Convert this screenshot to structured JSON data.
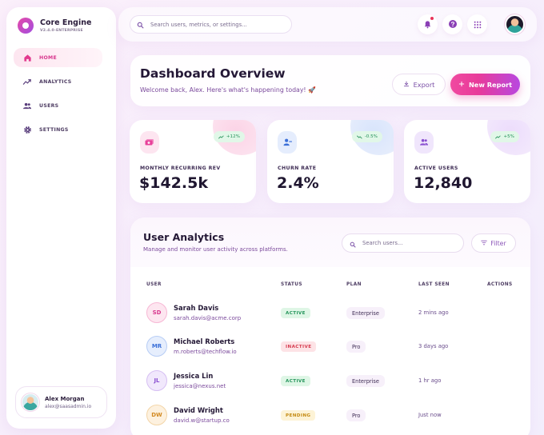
{
  "brand": {
    "name": "Core Engine",
    "version": "V2.4.0-ENTERPRISE"
  },
  "nav": [
    {
      "label": "HOME",
      "icon": "home-icon",
      "active": true
    },
    {
      "label": "ANALYTICS",
      "icon": "analytics-icon",
      "active": false
    },
    {
      "label": "USERS",
      "icon": "users-icon",
      "active": false
    },
    {
      "label": "SETTINGS",
      "icon": "gear-icon",
      "active": false
    }
  ],
  "profile": {
    "name": "Alex Morgan",
    "email": "alex@saasadmin.io"
  },
  "topbar": {
    "search_placeholder": "Search users, metrics, or settings..."
  },
  "hero": {
    "title": "Dashboard Overview",
    "subtitle": "Welcome back, Alex. Here's what's happening today! 🚀",
    "export_label": "Export",
    "new_report_label": "New Report"
  },
  "stats": [
    {
      "label": "MONTHLY RECURRING REV",
      "value": "$142.5k",
      "trend": "+12%",
      "trend_dir": "up",
      "icon": "revenue-icon",
      "accent": "#e8409a"
    },
    {
      "label": "CHURN RATE",
      "value": "2.4%",
      "trend": "-0.5%",
      "trend_dir": "down",
      "icon": "user-minus-icon",
      "accent": "#3a6fd8"
    },
    {
      "label": "ACTIVE USERS",
      "value": "12,840",
      "trend": "+5%",
      "trend_dir": "up",
      "icon": "users-icon",
      "accent": "#8a4fd0"
    }
  ],
  "table": {
    "title": "User Analytics",
    "subtitle": "Manage and monitor user activity across platforms.",
    "search_placeholder": "Search users...",
    "filter_label": "Filter",
    "columns": [
      "USER",
      "STATUS",
      "PLAN",
      "LAST SEEN",
      "ACTIONS"
    ],
    "rows": [
      {
        "initials": "SD",
        "name": "Sarah Davis",
        "email": "sarah.davis@acme.corp",
        "status": "ACTIVE",
        "plan": "Enterprise",
        "last_seen": "2 mins ago"
      },
      {
        "initials": "MR",
        "name": "Michael Roberts",
        "email": "m.roberts@techflow.io",
        "status": "INACTIVE",
        "plan": "Pro",
        "last_seen": "3 days ago"
      },
      {
        "initials": "JL",
        "name": "Jessica Lin",
        "email": "jessica@nexus.net",
        "status": "ACTIVE",
        "plan": "Enterprise",
        "last_seen": "1 hr ago"
      },
      {
        "initials": "DW",
        "name": "David Wright",
        "email": "david.w@startup.co",
        "status": "PENDING",
        "plan": "Pro",
        "last_seen": "Just now"
      }
    ]
  },
  "colors": {
    "accent_pink": "#e8409a",
    "accent_purple": "#b848e0",
    "text_dark": "#241836",
    "text_muted": "#7b4a9c"
  }
}
